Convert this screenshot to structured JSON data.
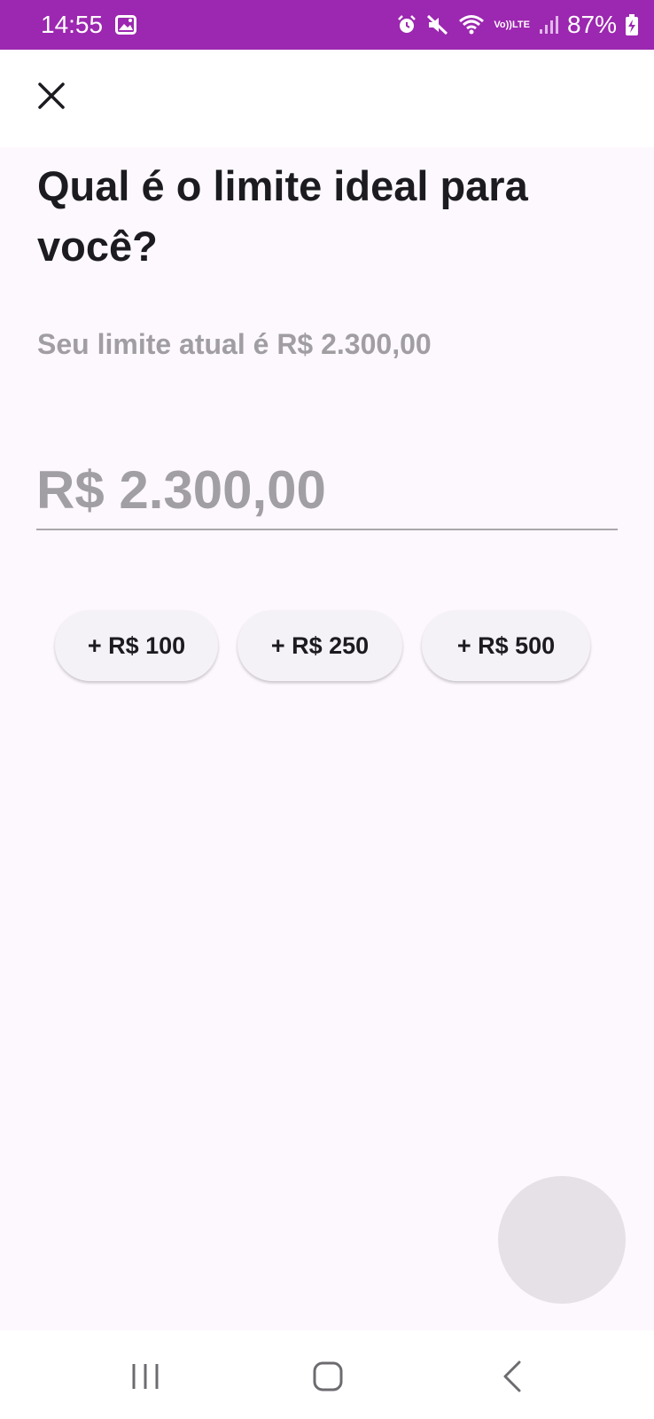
{
  "colors": {
    "status_bar": "#9c27b0",
    "background": "#fdf8fd",
    "title_text": "#1c1b1f",
    "muted_text": "#a09ea2",
    "chip_background": "#f5f2f7",
    "fab_background": "#e6e1e6"
  },
  "status_bar": {
    "time": "14:55",
    "battery": "87%",
    "network_label_top": "Vo))",
    "network_label_bottom": "LTE",
    "icons": [
      "gallery-icon",
      "alarm-icon",
      "mute-icon",
      "wifi-icon",
      "signal-icon",
      "battery-charging-icon"
    ]
  },
  "app_bar": {
    "close_icon": "close-icon"
  },
  "content": {
    "title": "Qual é o limite ideal para você?",
    "subtitle": "Seu limite atual é R$ 2.300,00",
    "amount_placeholder": "R$ 2.300,00",
    "chips": [
      "+ R$ 100",
      "+ R$ 250",
      "+ R$ 500"
    ]
  },
  "nav_bar": {
    "icons": [
      "recent-apps-icon",
      "home-icon",
      "back-icon"
    ]
  }
}
